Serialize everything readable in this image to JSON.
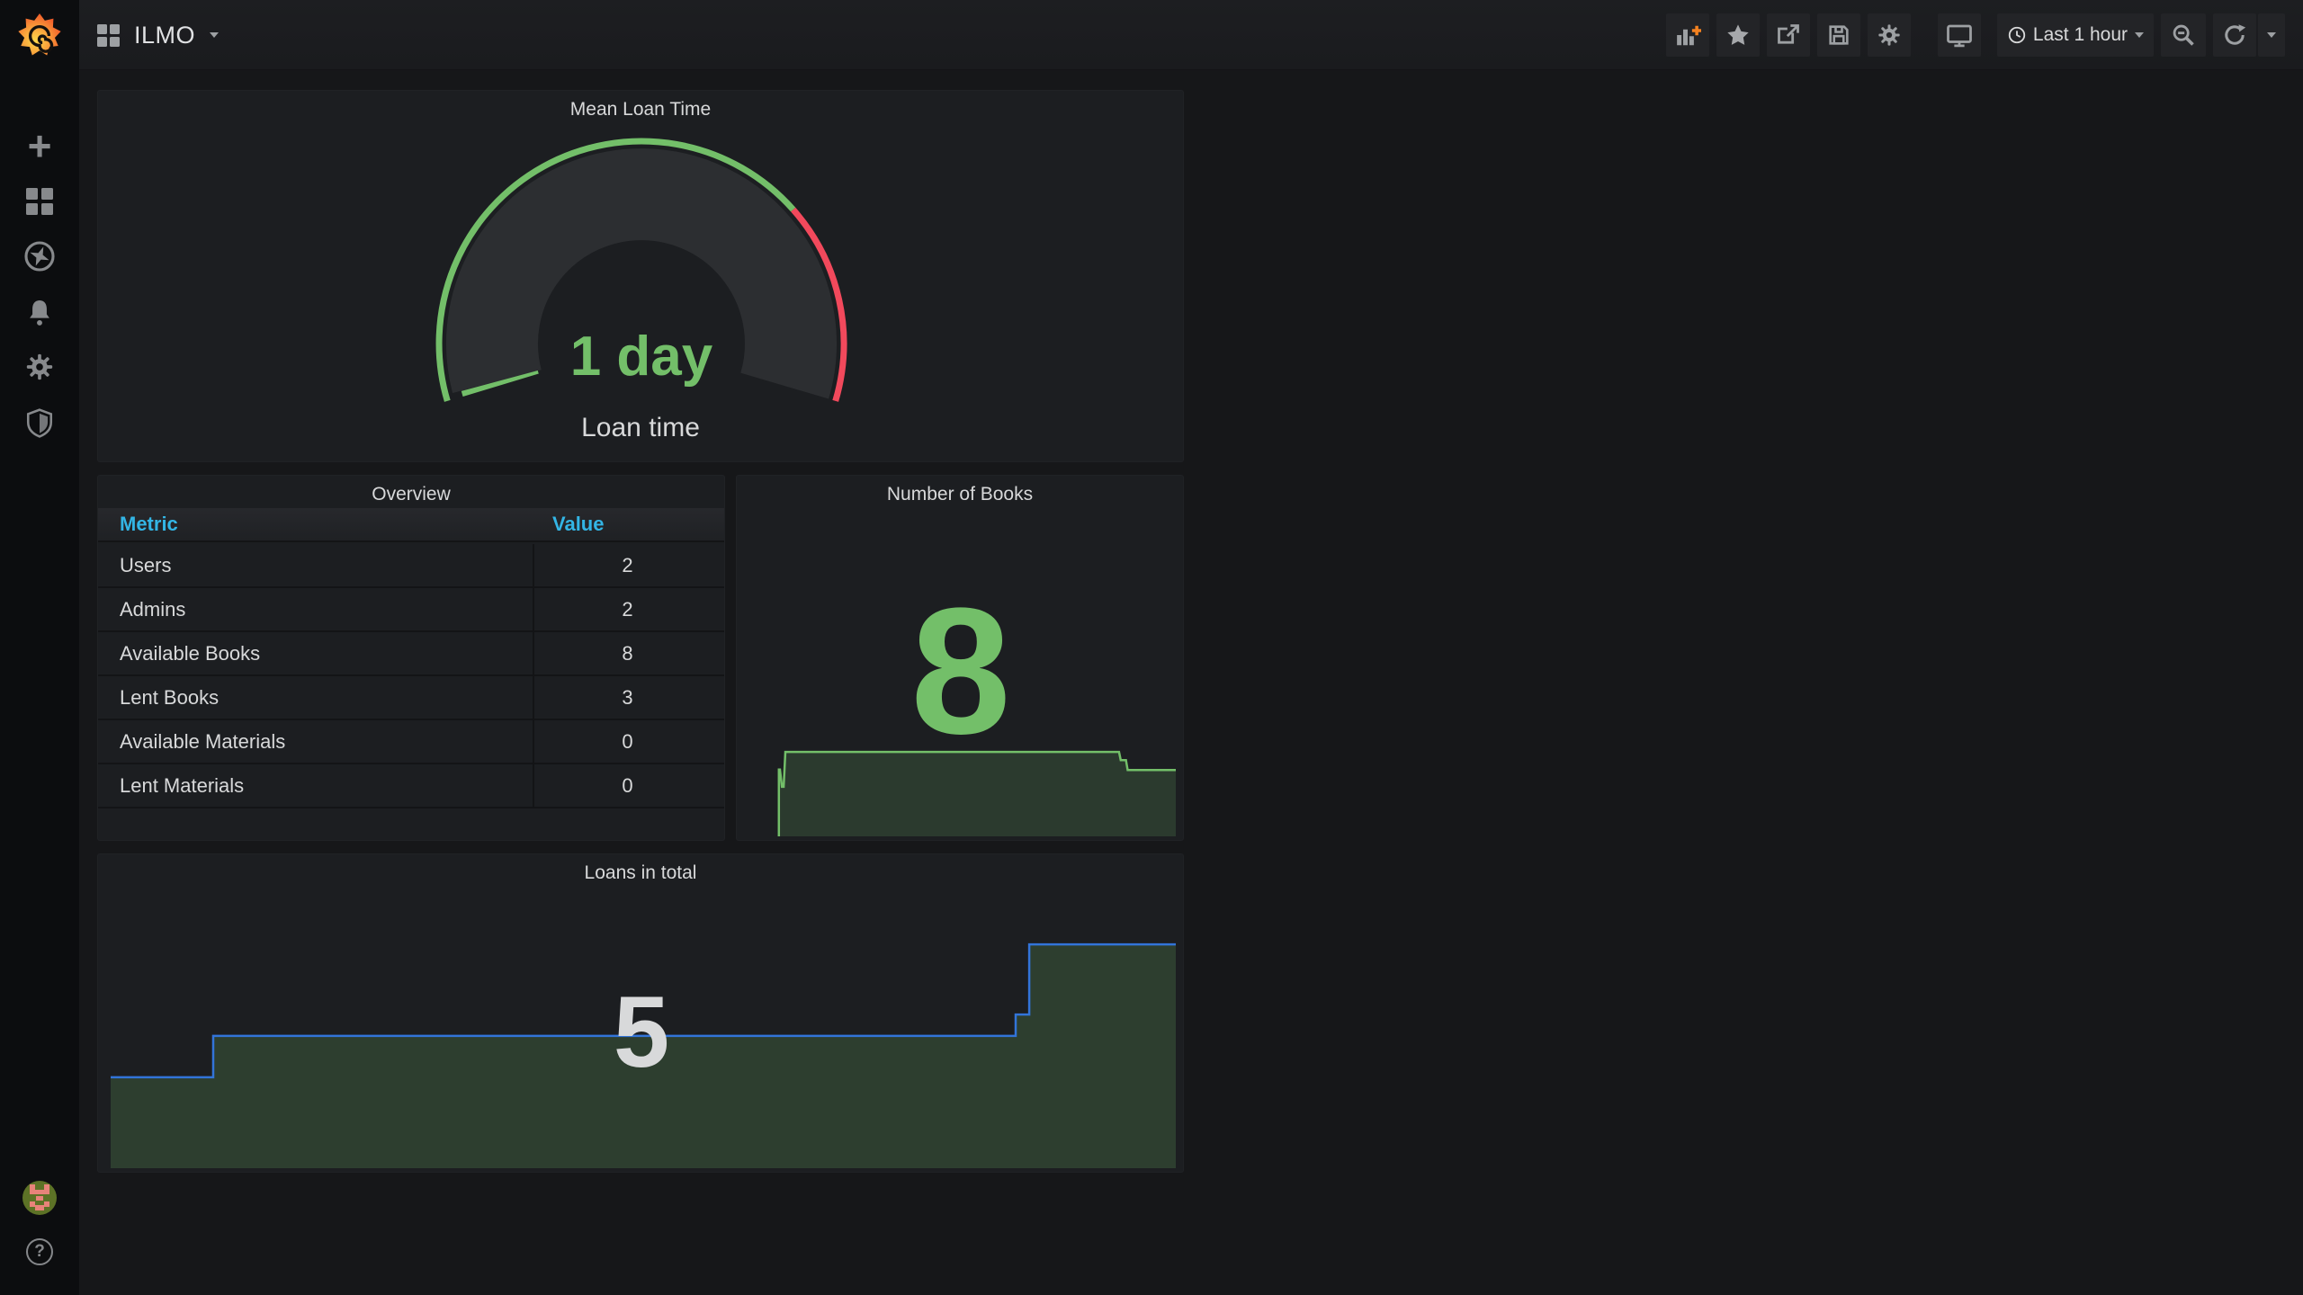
{
  "navbar": {
    "title": "ILMO",
    "time_range": "Last 1 hour"
  },
  "sidebar": {
    "help": "?"
  },
  "panels": {
    "gauge": {
      "title": "Mean Loan Time",
      "value": "1 day",
      "label": "Loan time"
    },
    "overview": {
      "title": "Overview",
      "columns": {
        "metric": "Metric",
        "value": "Value"
      }
    },
    "books": {
      "title": "Number of Books",
      "value": "8"
    },
    "loans": {
      "title": "Loans in total",
      "value": "5"
    }
  },
  "colors": {
    "green": "#73BF69",
    "red": "#F2495C",
    "blue": "#3274D9",
    "table_header": "#33B5E5"
  },
  "chart_data": [
    {
      "type": "gauge",
      "title": "Mean Loan Time",
      "value": "1 day",
      "label": "Loan time",
      "threshold_split_fraction": 0.728,
      "band_colors": [
        "#73BF69",
        "#F2495C"
      ],
      "value_color": "#73BF69"
    },
    {
      "type": "table",
      "title": "Overview",
      "columns": [
        "Metric",
        "Value"
      ],
      "rows": [
        [
          "Users",
          "2"
        ],
        [
          "Admins",
          "2"
        ],
        [
          "Available Books",
          "8"
        ],
        [
          "Lent Books",
          "3"
        ],
        [
          "Available Materials",
          "0"
        ],
        [
          "Lent Materials",
          "0"
        ]
      ]
    },
    {
      "type": "area",
      "title": "Number of Books",
      "current": 8,
      "line_color": "#73BF69",
      "fill_color": "rgba(115,191,105,0.18)",
      "points": [
        [
          0.077,
          1
        ],
        [
          0.077,
          0.3
        ],
        [
          0.0795,
          0.3
        ],
        [
          0.084,
          0.48
        ],
        [
          0.088,
          0.48
        ],
        [
          0.092,
          0.114
        ],
        [
          0.868,
          0.114
        ],
        [
          0.872,
          0.2
        ],
        [
          0.884,
          0.2
        ],
        [
          0.888,
          0.305
        ],
        [
          1,
          0.305
        ]
      ]
    },
    {
      "type": "area",
      "title": "Loans in total",
      "current": 5,
      "line_color": "#3274D9",
      "fill_color": "rgba(115,191,105,0.2)",
      "points": [
        [
          0,
          0.602
        ],
        [
          0.0963,
          0.602
        ],
        [
          0.0963,
          0.421
        ],
        [
          0.8497,
          0.421
        ],
        [
          0.8497,
          0.327
        ],
        [
          0.8624,
          0.327
        ],
        [
          0.8624,
          0.02
        ],
        [
          1,
          0.02
        ]
      ]
    }
  ]
}
